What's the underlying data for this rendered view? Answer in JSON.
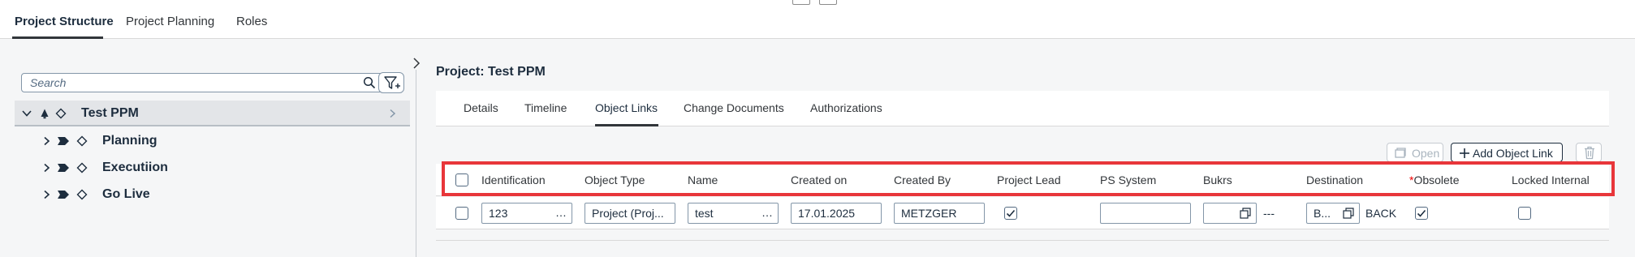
{
  "top_tabs": [
    {
      "label": "Project Structure",
      "active": true
    },
    {
      "label": "Project Planning",
      "active": false
    },
    {
      "label": "Roles",
      "active": false
    }
  ],
  "tree": {
    "search_placeholder": "Search",
    "root": {
      "label": "Test PPM"
    },
    "children": [
      {
        "label": "Planning"
      },
      {
        "label": "Executiion"
      },
      {
        "label": "Go Live"
      }
    ]
  },
  "main": {
    "title": "Project: Test PPM",
    "subtabs": [
      {
        "label": "Details"
      },
      {
        "label": "Timeline"
      },
      {
        "label": "Object Links",
        "active": true
      },
      {
        "label": "Change Documents"
      },
      {
        "label": "Authorizations"
      }
    ],
    "toolbar": {
      "open_label": "Open",
      "add_label": "Add Object Link"
    },
    "table": {
      "columns": {
        "identification": "Identification",
        "object_type": "Object Type",
        "name": "Name",
        "created_on": "Created on",
        "created_by": "Created By",
        "project_lead": "Project Lead",
        "ps_system": "PS System",
        "bukrs": "Bukrs",
        "destination": "Destination",
        "obsolete_required": "*",
        "obsolete": "Obsolete",
        "locked_internal": "Locked Internal"
      },
      "row": {
        "identification": "123",
        "object_type": "Project (Proj...",
        "name": "test",
        "created_on": "17.01.2025",
        "created_by": "METZGER",
        "project_lead_checked": true,
        "ps_system": "",
        "bukrs": "",
        "bukrs_text": "---",
        "destination": "B...",
        "destination_text": "BACK",
        "obsolete_checked": true,
        "locked_internal_checked": false
      }
    }
  },
  "colors": {
    "highlight": "#e8363a",
    "text": "#1d2d3e",
    "border": "#8396a8"
  }
}
